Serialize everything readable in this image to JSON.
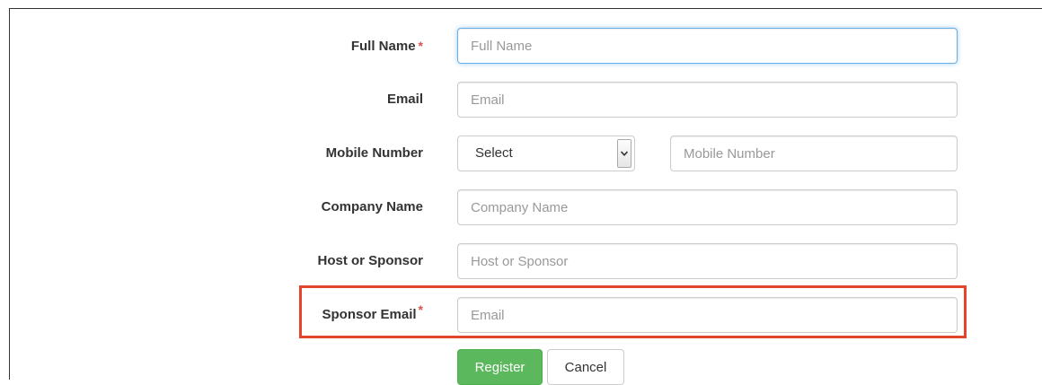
{
  "form": {
    "full_name": {
      "label": "Full Name",
      "required_mark": "*",
      "placeholder": "Full Name"
    },
    "email": {
      "label": "Email",
      "placeholder": "Email"
    },
    "mobile": {
      "label": "Mobile Number",
      "select_value": "Select",
      "placeholder": "Mobile Number"
    },
    "company": {
      "label": "Company Name",
      "placeholder": "Company Name"
    },
    "host": {
      "label": "Host or Sponsor",
      "placeholder": "Host or Sponsor"
    },
    "sponsor_email": {
      "label": "Sponsor Email",
      "required_mark": "*",
      "placeholder": "Email"
    },
    "buttons": {
      "register": "Register",
      "cancel": "Cancel"
    }
  },
  "colors": {
    "required": "#d9534f",
    "highlight": "#e2452b",
    "register_bg": "#5cb85c",
    "focus_border": "#66afe9"
  },
  "icons": {
    "select_arrow": "chevron-down-icon"
  }
}
